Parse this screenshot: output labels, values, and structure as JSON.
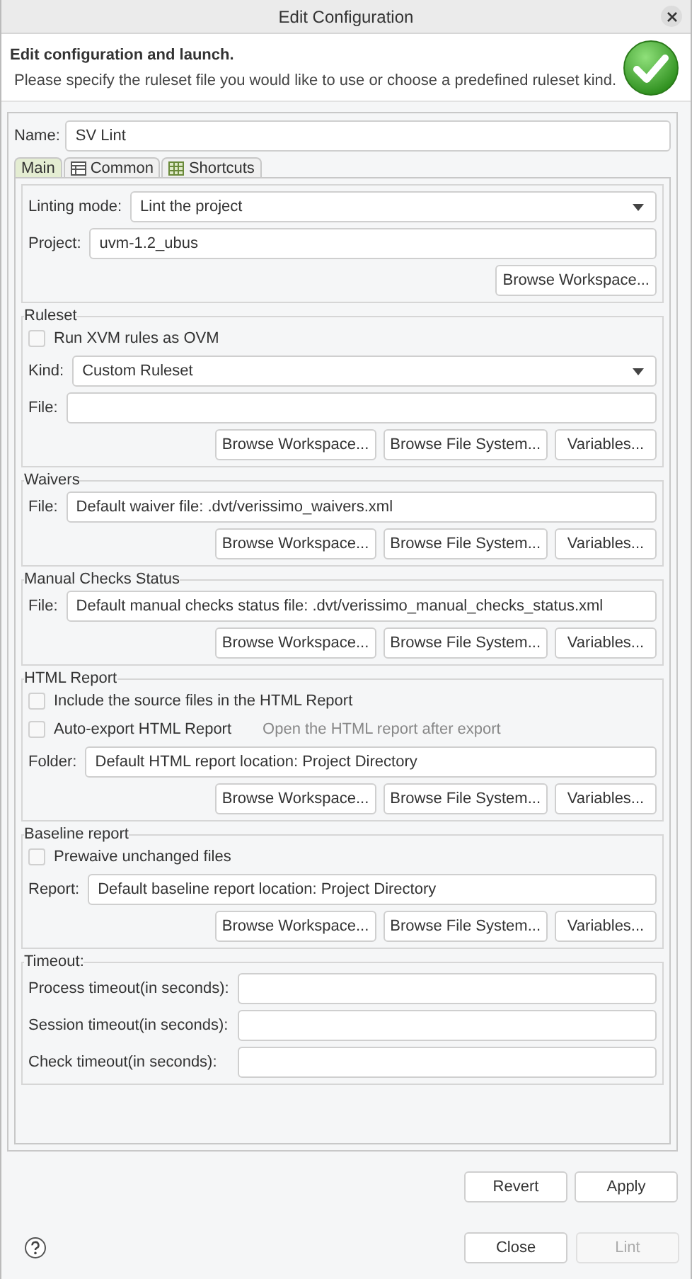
{
  "window": {
    "title": "Edit Configuration"
  },
  "header": {
    "title": "Edit configuration and launch.",
    "message": "Please specify the ruleset file you would like to use or choose a predefined ruleset kind."
  },
  "name_field": {
    "label": "Name:",
    "value": "SV Lint"
  },
  "tabs": [
    {
      "label": "Main",
      "selected": true
    },
    {
      "label": "Common",
      "selected": false
    },
    {
      "label": "Shortcuts",
      "selected": false
    }
  ],
  "sections": [
    {
      "rows": [
        {
          "kind": "combo",
          "label": "Linting mode:",
          "value": "Lint the project"
        },
        {
          "kind": "field",
          "label": "Project:",
          "value": "uvm-1.2_ubus"
        },
        {
          "kind": "buttons",
          "buttons": [
            "Browse Workspace..."
          ]
        }
      ]
    },
    {
      "title": "Ruleset",
      "rows": [
        {
          "kind": "checkbox",
          "label": "Run XVM rules as OVM",
          "checked": false
        },
        {
          "kind": "combo",
          "label": "Kind:",
          "value": "Custom Ruleset"
        },
        {
          "kind": "field",
          "label": "File:"
        },
        {
          "kind": "buttons",
          "buttons": [
            "Browse Workspace...",
            "Browse File System...",
            "Variables..."
          ]
        }
      ]
    },
    {
      "title": "Waivers",
      "rows": [
        {
          "kind": "field",
          "label": "File:",
          "value": "Default waiver file: .dvt/verissimo_waivers.xml"
        },
        {
          "kind": "buttons",
          "buttons": [
            "Browse Workspace...",
            "Browse File System...",
            "Variables..."
          ]
        }
      ]
    },
    {
      "title": "Manual Checks Status",
      "rows": [
        {
          "kind": "field",
          "label": "File:",
          "value": "Default manual checks status file: .dvt/verissimo_manual_checks_status.xml"
        },
        {
          "kind": "buttons",
          "buttons": [
            "Browse Workspace...",
            "Browse File System...",
            "Variables..."
          ]
        }
      ]
    },
    {
      "title": "HTML Report",
      "rows": [
        {
          "kind": "checkbox",
          "label": "Include the source files in the HTML Report",
          "checked": false
        },
        {
          "kind": "checkbox",
          "label": "Auto-export HTML Report",
          "checked": false,
          "hint": "Open the HTML report after export"
        },
        {
          "kind": "field",
          "label": "Folder:",
          "value": "Default HTML report location: Project Directory"
        },
        {
          "kind": "buttons",
          "buttons": [
            "Browse Workspace...",
            "Browse File System...",
            "Variables..."
          ]
        }
      ]
    },
    {
      "title": "Baseline report",
      "rows": [
        {
          "kind": "checkbox",
          "label": "Prewaive unchanged files",
          "checked": false
        },
        {
          "kind": "field",
          "label": "Report:",
          "value": "Default baseline report location: Project Directory"
        },
        {
          "kind": "buttons",
          "buttons": [
            "Browse Workspace...",
            "Browse File System...",
            "Variables..."
          ]
        }
      ]
    },
    {
      "title": "Timeout:",
      "rows": [
        {
          "kind": "wide-field",
          "label": "Process timeout(in seconds):"
        },
        {
          "kind": "wide-field",
          "label": "Session timeout(in seconds):"
        },
        {
          "kind": "wide-field",
          "label": "Check timeout(in seconds):"
        }
      ]
    }
  ],
  "panel_buttons": [
    {
      "label": "Revert",
      "disabled": false
    },
    {
      "label": "Apply",
      "disabled": false
    }
  ],
  "dialog_buttons": [
    {
      "label": "Close",
      "disabled": false
    },
    {
      "label": "Lint",
      "disabled": true
    }
  ]
}
